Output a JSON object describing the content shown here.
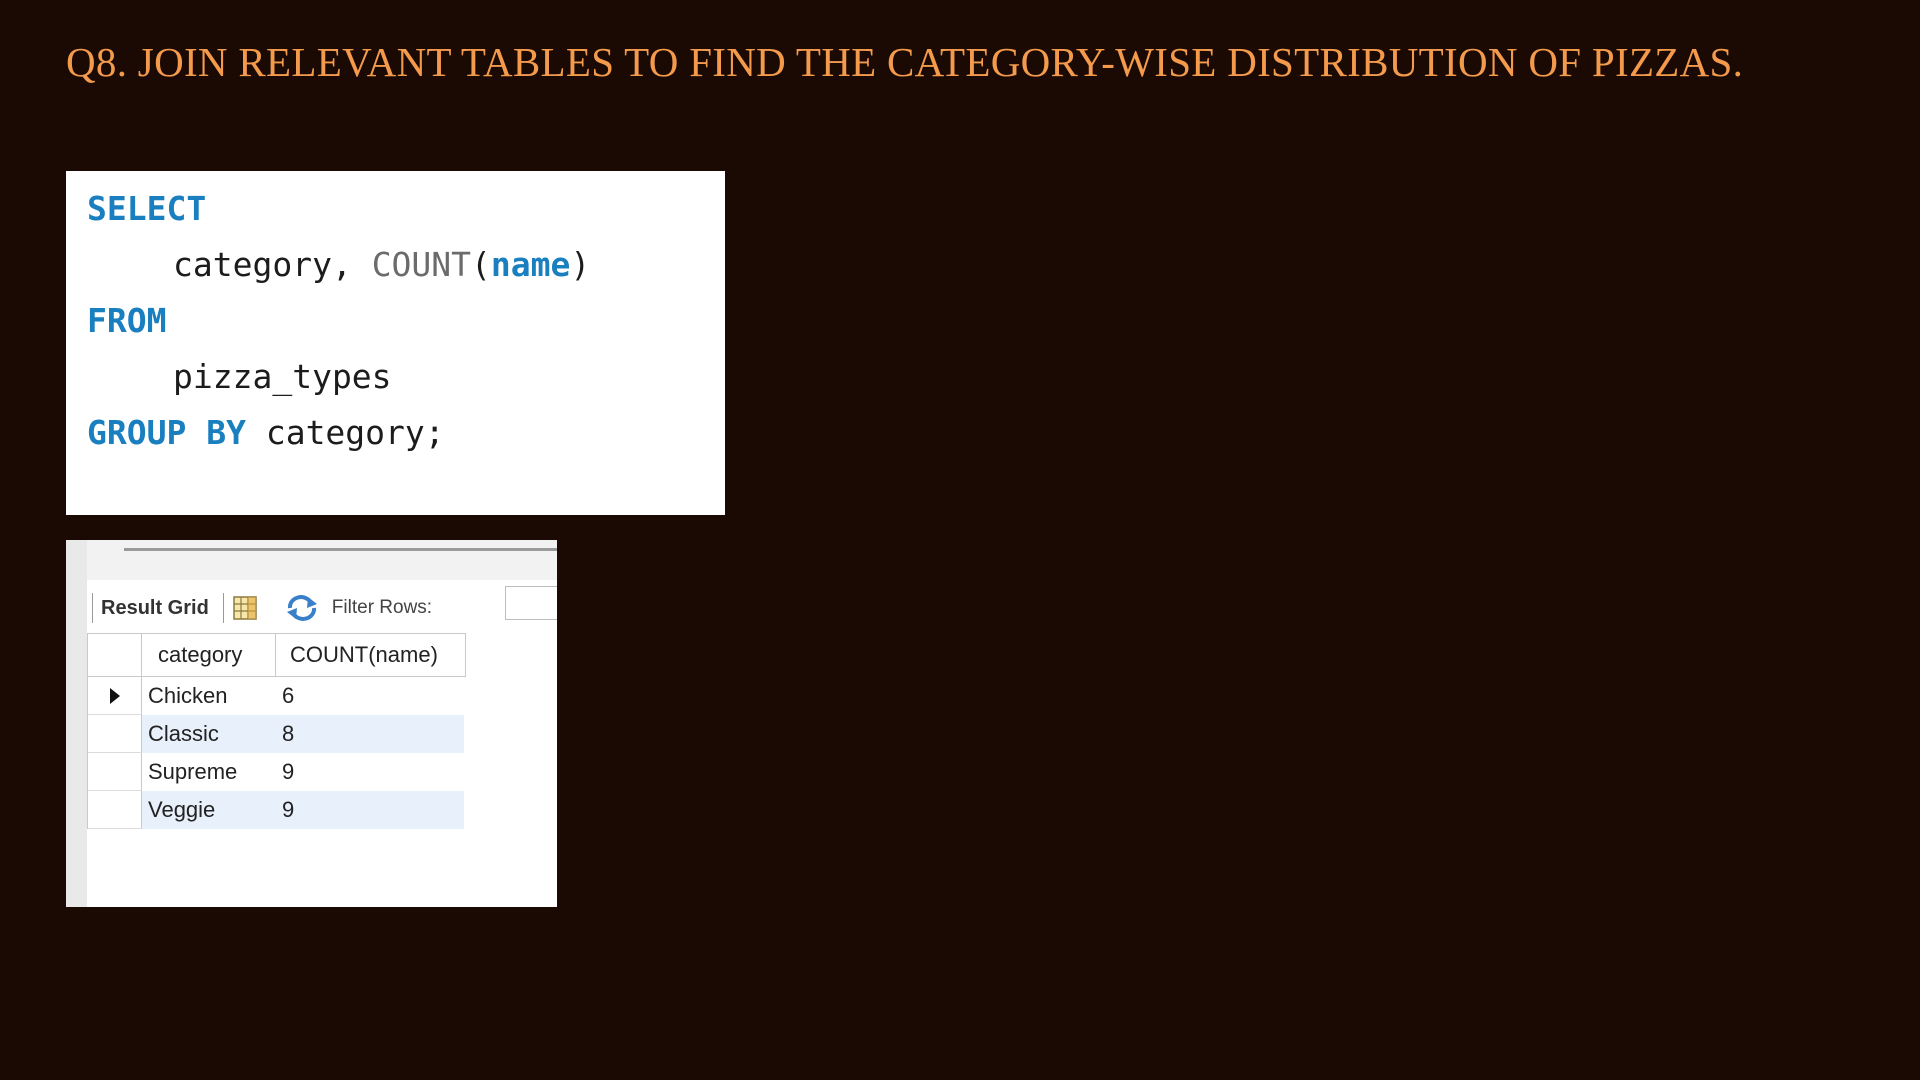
{
  "slide": {
    "title": "Q8. JOIN RELEVANT TABLES TO FIND THE CATEGORY-WISE DISTRIBUTION OF PIZZAS."
  },
  "sql": {
    "select_kw": "SELECT",
    "col_category": "category,",
    "fn_count": "COUNT",
    "paren_open": "(",
    "arg_name": "name",
    "paren_close": ")",
    "from_kw": "FROM",
    "table_name": "pizza_types",
    "group_by_kw": "GROUP BY",
    "group_col": "category;"
  },
  "result": {
    "toolbar": {
      "result_grid_label": "Result Grid",
      "filter_label": "Filter Rows:",
      "filter_value": ""
    },
    "columns": [
      "category",
      "COUNT(name)"
    ],
    "rows": [
      {
        "category": "Chicken",
        "count": "6"
      },
      {
        "category": "Classic",
        "count": "8"
      },
      {
        "category": "Supreme",
        "count": "9"
      },
      {
        "category": "Veggie",
        "count": "9"
      }
    ],
    "icons": [
      "grid-view-icon",
      "refresh-icon",
      "row-pointer-icon"
    ]
  },
  "colors": {
    "background": "#1b0a03",
    "title": "#f39a4c",
    "sql_keyword": "#1a7fbf",
    "row_highlight": "#e8f0fb"
  }
}
